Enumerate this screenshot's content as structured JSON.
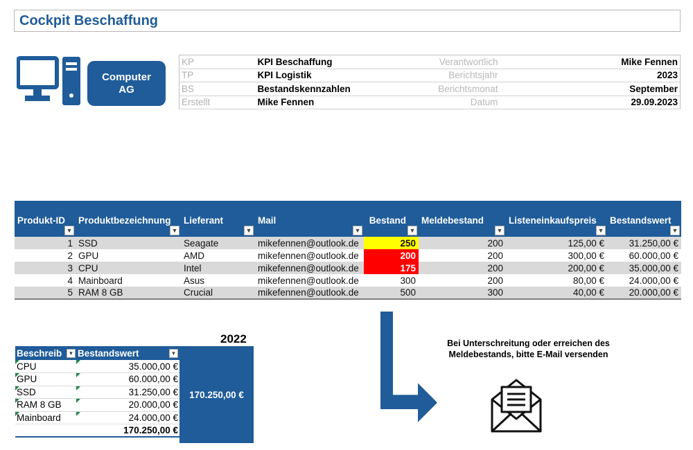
{
  "title": "Cockpit Beschaffung",
  "logo": {
    "line1": "Computer",
    "line2": "AG",
    "icon": "computer-tower-icon",
    "color": "#1f5c99"
  },
  "meta": [
    {
      "code": "KP",
      "value": "KPI Beschaffung",
      "label": "Verantwortlich",
      "rvalue": "Mike Fennen"
    },
    {
      "code": "TP",
      "value": "KPI Logistik",
      "label": "Berichtsjahr",
      "rvalue": "2023"
    },
    {
      "code": "BS",
      "value": "Bestandskennzahlen",
      "label": "Berichtsmonat",
      "rvalue": "September"
    },
    {
      "code": "Erstellt",
      "value": "Mike Fennen",
      "label": "Datum",
      "rvalue": "29.09.2023"
    }
  ],
  "table": {
    "headers": [
      "Produkt-ID",
      "Produktbezeichnung",
      "Lieferant",
      "Mail",
      "Bestand",
      "Meldebestand",
      "Listeneinkaufspreis",
      "Bestandswert"
    ],
    "rows": [
      {
        "id": "1",
        "name": "SSD",
        "supplier": "Seagate",
        "mail": "mikefennen@outlook.de",
        "stock": "250",
        "reorder": "200",
        "price": "125,00 €",
        "value": "31.250,00 €",
        "highlight": "yellow"
      },
      {
        "id": "2",
        "name": "GPU",
        "supplier": "AMD",
        "mail": "mikefennen@outlook.de",
        "stock": "200",
        "reorder": "200",
        "price": "300,00 €",
        "value": "60.000,00 €",
        "highlight": "red"
      },
      {
        "id": "3",
        "name": "CPU",
        "supplier": "Intel",
        "mail": "mikefennen@outlook.de",
        "stock": "175",
        "reorder": "200",
        "price": "200,00 €",
        "value": "35.000,00 €",
        "highlight": "red"
      },
      {
        "id": "4",
        "name": "Mainboard",
        "supplier": "Asus",
        "mail": "mikefennen@outlook.de",
        "stock": "300",
        "reorder": "200",
        "price": "80,00 €",
        "value": "24.000,00 €",
        "highlight": "none"
      },
      {
        "id": "5",
        "name": "RAM 8 GB",
        "supplier": "Crucial",
        "mail": "mikefennen@outlook.de",
        "stock": "500",
        "reorder": "300",
        "price": "40,00 €",
        "value": "20.000,00 €",
        "highlight": "none"
      }
    ]
  },
  "pivot": {
    "year": "2022",
    "headers": [
      "Beschreib",
      "Bestandswert"
    ],
    "rows": [
      {
        "label": "CPU",
        "value": "35.000,00 €"
      },
      {
        "label": "GPU",
        "value": "60.000,00 €"
      },
      {
        "label": "SSD",
        "value": "31.250,00 €"
      },
      {
        "label": "RAM 8 GB",
        "value": "20.000,00 €"
      },
      {
        "label": "Mainboard",
        "value": "24.000,00 €"
      }
    ],
    "total": "170.250,00 €",
    "summary": "170.250,00 €"
  },
  "note": "Bei Unterschreitung oder erreichen des Meldebestands, bitte E-Mail versenden",
  "icons": {
    "arrow": "arrow-down-right-icon",
    "mail": "open-envelope-icon"
  },
  "colors": {
    "accent": "#1f5c99",
    "warn": "#ffff00",
    "alert": "#ff0000"
  }
}
